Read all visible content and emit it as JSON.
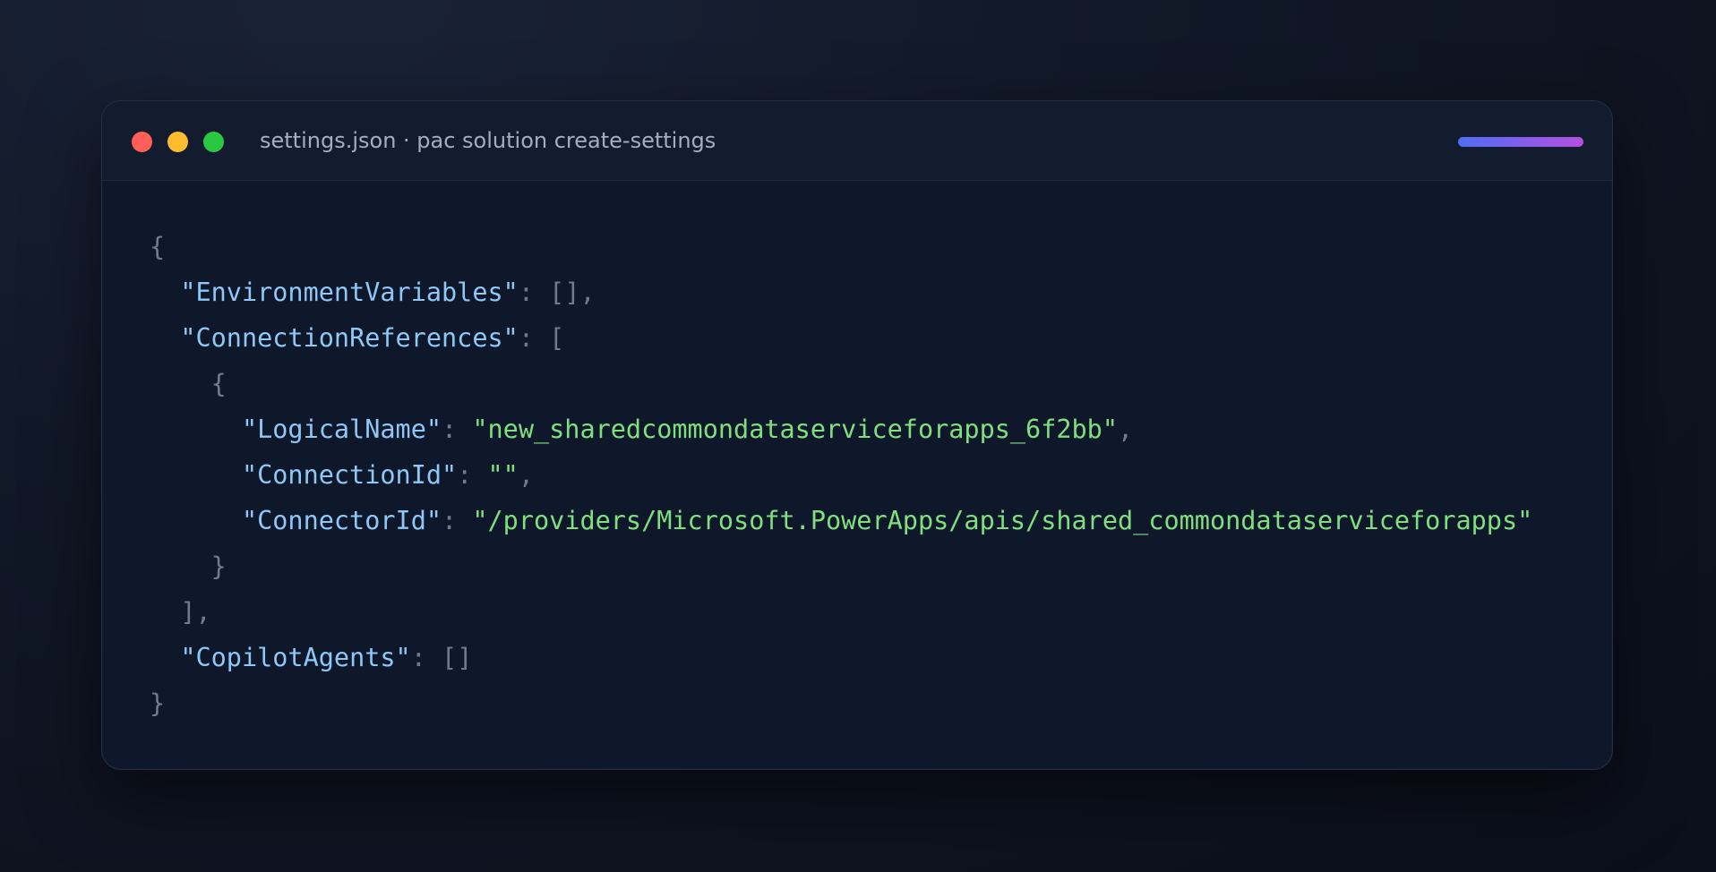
{
  "window": {
    "title": "settings.json · pac solution create-settings",
    "controls": [
      "close",
      "minimize",
      "maximize"
    ]
  },
  "code": {
    "language": "json",
    "lines": [
      {
        "indent": "",
        "key": "",
        "sep": "",
        "value": "",
        "punc": "{"
      },
      {
        "indent": "  ",
        "key": "\"EnvironmentVariables\"",
        "sep": ": ",
        "value": "",
        "punc": "[],"
      },
      {
        "indent": "  ",
        "key": "\"ConnectionReferences\"",
        "sep": ": ",
        "value": "",
        "punc": "["
      },
      {
        "indent": "    ",
        "key": "",
        "sep": "",
        "value": "",
        "punc": "{"
      },
      {
        "indent": "      ",
        "key": "\"LogicalName\"",
        "sep": ": ",
        "value": "\"new_sharedcommondataserviceforapps_6f2bb\"",
        "punc": ","
      },
      {
        "indent": "      ",
        "key": "\"ConnectionId\"",
        "sep": ": ",
        "value": "\"\"",
        "punc": ","
      },
      {
        "indent": "      ",
        "key": "\"ConnectorId\"",
        "sep": ": ",
        "value": "\"/providers/Microsoft.PowerApps/apis/shared_commondataserviceforapps\"",
        "punc": ""
      },
      {
        "indent": "    ",
        "key": "",
        "sep": "",
        "value": "",
        "punc": "}"
      },
      {
        "indent": "  ",
        "key": "",
        "sep": "",
        "value": "",
        "punc": "],"
      },
      {
        "indent": "  ",
        "key": "\"CopilotAgents\"",
        "sep": ": ",
        "value": "",
        "punc": "[]"
      },
      {
        "indent": "",
        "key": "",
        "sep": "",
        "value": "",
        "punc": "}"
      }
    ]
  },
  "colors": {
    "key": "#8ec8f6",
    "string": "#7ee07e",
    "punctuation": "#6f7b91",
    "window_bg": "#0f172a",
    "titlebar_bg": "#131c2e",
    "dot_red": "#ff5f57",
    "dot_yellow": "#febc2e",
    "dot_green": "#28c840",
    "accent_gradient": [
      "#4f6df5",
      "#b44fe0"
    ]
  }
}
